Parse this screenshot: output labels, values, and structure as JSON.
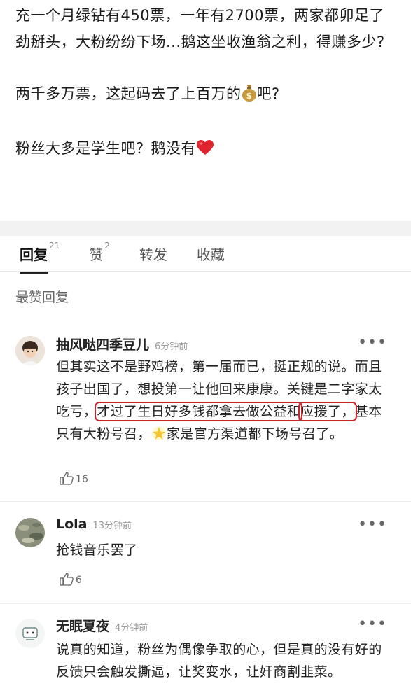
{
  "post": {
    "para1": "充一个月绿钻有450票，一年有2700票，两家都卯足了劲掰头，大粉纷纷下场...鹅这坐收渔翁之利，得赚多少?",
    "para2_text": "两千多万票，这起码去了上百万的",
    "para2_end": "吧?",
    "para3_text": "粉丝大多是学生吧？鹅没有"
  },
  "tabs": [
    {
      "label": "回复",
      "count": "21"
    },
    {
      "label": "赞",
      "count": "2"
    },
    {
      "label": "转发",
      "count": ""
    },
    {
      "label": "收藏",
      "count": ""
    }
  ],
  "section_title": "最赞回复",
  "comments": [
    {
      "name": "抽风哒四季豆儿",
      "time": "6分钟前",
      "text_a": "但其实这不是野鸡榜，第一届而已，挺正规的说。而且孩子出国了，想投第一让他回来康康。关键是二字家太吃亏，",
      "text_highlight1": "才过了生日好多钱都拿去做公益和",
      "text_highlight2": "应援了，",
      "text_b": "基本只有大粉号召，",
      "text_c": "家是官方渠道都下场号召了。",
      "likes": "16"
    },
    {
      "name": "Lola",
      "time": "13分钟前",
      "text": "抢钱音乐罢了",
      "likes": "6"
    },
    {
      "name": "无眠夏夜",
      "time": "4分钟前",
      "text": "说真的知道，粉丝为偶像争取的心，但是真的没有好的反馈只会触发撕逼，让奖变水，让奸商割韭菜。"
    }
  ],
  "icons": {
    "money_bag": "money-bag-icon",
    "heart": "red-heart-icon",
    "star": "glowing-star-icon",
    "like": "thumb-up-icon",
    "more": "more-dots-icon"
  },
  "colors": {
    "highlight_circle": "#c8252c",
    "heart": "#e0242f"
  }
}
